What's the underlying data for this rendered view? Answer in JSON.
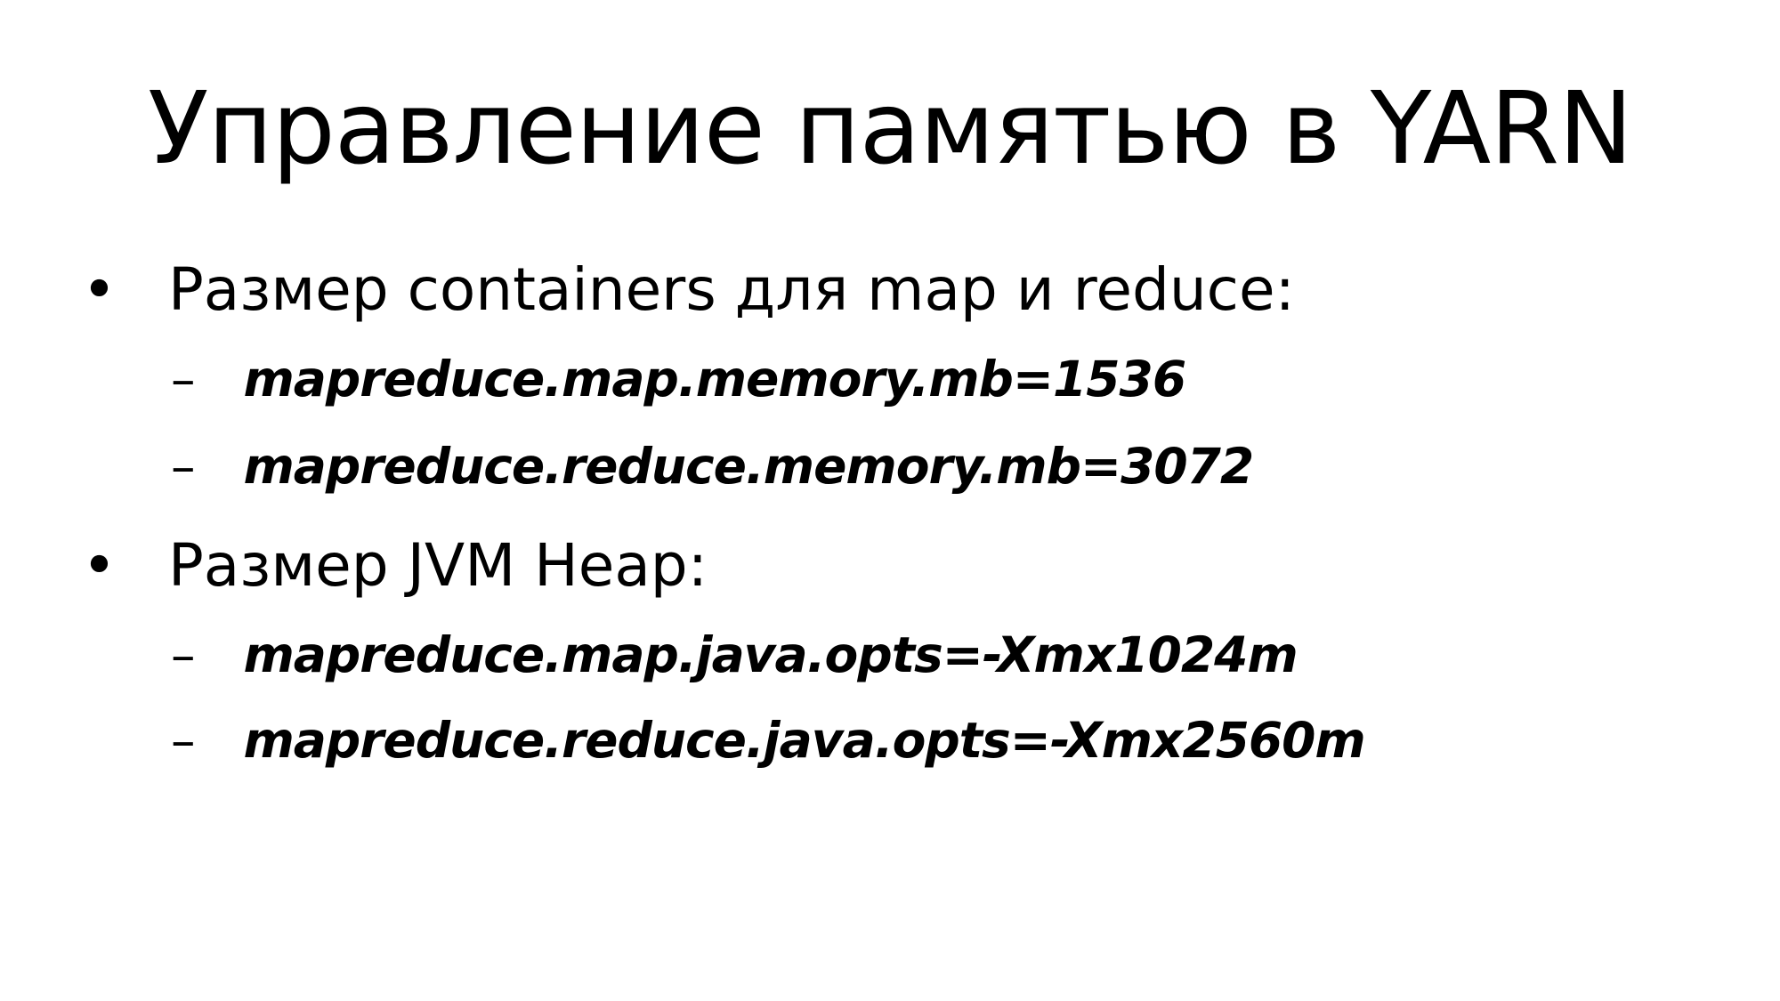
{
  "slide": {
    "title": "Управление памятью в YARN",
    "bullets": [
      {
        "marker": "•",
        "text": "Размер containers для map и reduce:",
        "subitems": [
          {
            "marker": "–",
            "text": "mapreduce.map.memory.mb=1536"
          },
          {
            "marker": "–",
            "text": "mapreduce.reduce.memory.mb=3072"
          }
        ]
      },
      {
        "marker": "•",
        "text": "Размер JVM Heap:",
        "subitems": [
          {
            "marker": "–",
            "text": "mapreduce.map.java.opts=-Xmx1024m"
          },
          {
            "marker": "–",
            "text": "mapreduce.reduce.java.opts=-Xmx2560m"
          }
        ]
      }
    ]
  },
  "colors": {
    "background": "#ffffff",
    "text": "#000000"
  }
}
